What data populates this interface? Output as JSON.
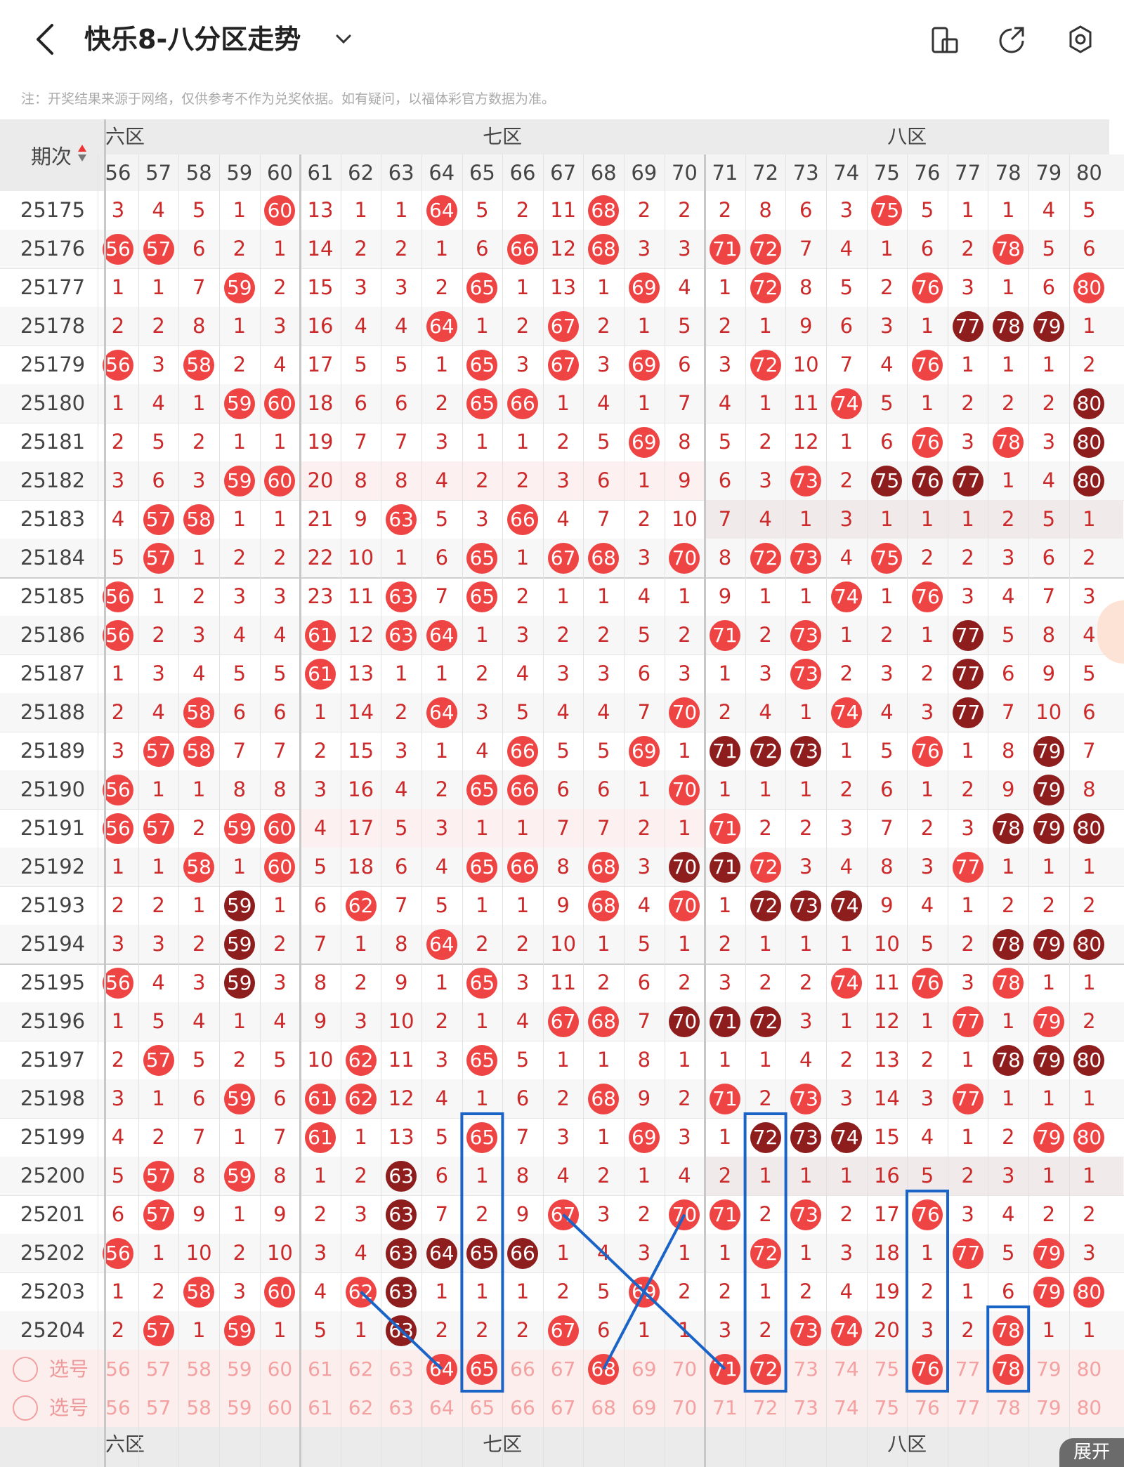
{
  "header": {
    "title": "快乐8-八分区走势",
    "note": "注：开奖结果来源于网络，仅供参考不作为兑奖依据。如有疑问，以福体彩官方数据为准。"
  },
  "table": {
    "period_header": "期次",
    "zones": [
      "六区",
      "七区",
      "八区"
    ],
    "columns": [
      "56",
      "57",
      "58",
      "59",
      "60",
      "61",
      "62",
      "63",
      "64",
      "65",
      "66",
      "67",
      "68",
      "69",
      "70",
      "71",
      "72",
      "73",
      "74",
      "75",
      "76",
      "77",
      "78",
      "79",
      "80"
    ],
    "rows": [
      {
        "period": "25175",
        "cells": [
          "3",
          "4",
          "5",
          "1",
          "c60",
          "13",
          "1",
          "1",
          "c64",
          "5",
          "2",
          "11",
          "c68",
          "2",
          "2",
          "2",
          "8",
          "6",
          "3",
          "c75",
          "5",
          "1",
          "1",
          "4",
          "5"
        ]
      },
      {
        "period": "25176",
        "cells": [
          "c56",
          "c57",
          "6",
          "2",
          "1",
          "14",
          "2",
          "2",
          "1",
          "6",
          "c66",
          "12",
          "c68",
          "3",
          "3",
          "c71",
          "c72",
          "7",
          "4",
          "1",
          "6",
          "2",
          "c78",
          "5",
          "6"
        ]
      },
      {
        "period": "25177",
        "cells": [
          "1",
          "1",
          "7",
          "c59",
          "2",
          "15",
          "3",
          "3",
          "2",
          "c65",
          "1",
          "13",
          "1",
          "c69",
          "4",
          "1",
          "c72",
          "8",
          "5",
          "2",
          "c76",
          "3",
          "1",
          "6",
          "c80"
        ]
      },
      {
        "period": "25178",
        "cells": [
          "2",
          "2",
          "8",
          "1",
          "3",
          "16",
          "4",
          "4",
          "c64",
          "1",
          "2",
          "c67",
          "2",
          "1",
          "5",
          "2",
          "1",
          "9",
          "6",
          "3",
          "1",
          "d77",
          "d78",
          "d79",
          "1"
        ]
      },
      {
        "period": "25179",
        "cells": [
          "c56",
          "3",
          "c58",
          "2",
          "4",
          "17",
          "5",
          "5",
          "1",
          "c65",
          "3",
          "c67",
          "3",
          "c69",
          "6",
          "3",
          "c72",
          "10",
          "7",
          "4",
          "c76",
          "1",
          "1",
          "1",
          "2"
        ]
      },
      {
        "period": "25180",
        "cells": [
          "1",
          "4",
          "1",
          "c59",
          "c60",
          "18",
          "6",
          "6",
          "2",
          "c65",
          "c66",
          "1",
          "4",
          "1",
          "7",
          "4",
          "1",
          "11",
          "c74",
          "5",
          "1",
          "2",
          "2",
          "2",
          "d80"
        ]
      },
      {
        "period": "25181",
        "cells": [
          "2",
          "5",
          "2",
          "1",
          "1",
          "19",
          "7",
          "7",
          "3",
          "1",
          "1",
          "2",
          "5",
          "c69",
          "8",
          "5",
          "2",
          "12",
          "1",
          "6",
          "c76",
          "3",
          "c78",
          "3",
          "d80"
        ]
      },
      {
        "period": "25182",
        "cells": [
          "3",
          "6",
          "3",
          "c59",
          "c60",
          "20",
          "8",
          "8",
          "4",
          "2",
          "2",
          "3",
          "6",
          "1",
          "9",
          "6",
          "3",
          "c73",
          "2",
          "d75",
          "d76",
          "d77",
          "1",
          "4",
          "d80"
        ]
      },
      {
        "period": "25183",
        "cells": [
          "4",
          "c57",
          "c58",
          "1",
          "1",
          "21",
          "9",
          "c63",
          "5",
          "3",
          "c66",
          "4",
          "7",
          "2",
          "10",
          "7",
          "4",
          "1",
          "3",
          "1",
          "1",
          "1",
          "2",
          "5",
          "1"
        ]
      },
      {
        "period": "25184",
        "cells": [
          "5",
          "c57",
          "1",
          "2",
          "2",
          "22",
          "10",
          "1",
          "6",
          "c65",
          "1",
          "c67",
          "c68",
          "3",
          "c70",
          "8",
          "c72",
          "c73",
          "4",
          "c75",
          "2",
          "2",
          "3",
          "6",
          "2"
        ]
      },
      {
        "period": "25185",
        "cells": [
          "c56",
          "1",
          "2",
          "3",
          "3",
          "23",
          "11",
          "c63",
          "7",
          "c65",
          "2",
          "1",
          "1",
          "4",
          "1",
          "9",
          "1",
          "1",
          "c74",
          "1",
          "c76",
          "3",
          "4",
          "7",
          "3"
        ]
      },
      {
        "period": "25186",
        "cells": [
          "c56",
          "2",
          "3",
          "4",
          "4",
          "c61",
          "12",
          "c63",
          "c64",
          "1",
          "3",
          "2",
          "2",
          "5",
          "2",
          "c71",
          "2",
          "c73",
          "1",
          "2",
          "1",
          "d77",
          "5",
          "8",
          "4"
        ]
      },
      {
        "period": "25187",
        "cells": [
          "1",
          "3",
          "4",
          "5",
          "5",
          "c61",
          "13",
          "1",
          "1",
          "2",
          "4",
          "3",
          "3",
          "6",
          "3",
          "1",
          "3",
          "c73",
          "2",
          "3",
          "2",
          "d77",
          "6",
          "9",
          "5"
        ]
      },
      {
        "period": "25188",
        "cells": [
          "2",
          "4",
          "c58",
          "6",
          "6",
          "1",
          "14",
          "2",
          "c64",
          "3",
          "5",
          "4",
          "4",
          "7",
          "c70",
          "2",
          "4",
          "1",
          "c74",
          "4",
          "3",
          "d77",
          "7",
          "10",
          "6"
        ]
      },
      {
        "period": "25189",
        "cells": [
          "3",
          "c57",
          "c58",
          "7",
          "7",
          "2",
          "15",
          "3",
          "1",
          "4",
          "c66",
          "5",
          "5",
          "c69",
          "1",
          "d71",
          "d72",
          "d73",
          "1",
          "5",
          "c76",
          "1",
          "8",
          "d79",
          "7"
        ]
      },
      {
        "period": "25190",
        "cells": [
          "c56",
          "1",
          "1",
          "8",
          "8",
          "3",
          "16",
          "4",
          "2",
          "c65",
          "c66",
          "6",
          "6",
          "1",
          "c70",
          "1",
          "1",
          "1",
          "2",
          "6",
          "1",
          "2",
          "9",
          "d79",
          "8"
        ]
      },
      {
        "period": "25191",
        "cells": [
          "c56",
          "c57",
          "2",
          "c59",
          "c60",
          "4",
          "17",
          "5",
          "3",
          "1",
          "1",
          "7",
          "7",
          "2",
          "1",
          "c71",
          "2",
          "2",
          "3",
          "7",
          "2",
          "3",
          "d78",
          "d79",
          "d80"
        ]
      },
      {
        "period": "25192",
        "cells": [
          "1",
          "1",
          "c58",
          "1",
          "c60",
          "5",
          "18",
          "6",
          "4",
          "c65",
          "c66",
          "8",
          "c68",
          "3",
          "d70",
          "d71",
          "c72",
          "3",
          "4",
          "8",
          "3",
          "c77",
          "1",
          "1",
          "1"
        ]
      },
      {
        "period": "25193",
        "cells": [
          "2",
          "2",
          "1",
          "d59",
          "1",
          "6",
          "c62",
          "7",
          "5",
          "1",
          "1",
          "9",
          "c68",
          "4",
          "c70",
          "1",
          "d72",
          "d73",
          "d74",
          "9",
          "4",
          "1",
          "2",
          "2",
          "2"
        ]
      },
      {
        "period": "25194",
        "cells": [
          "3",
          "3",
          "2",
          "d59",
          "2",
          "7",
          "1",
          "8",
          "c64",
          "2",
          "2",
          "10",
          "1",
          "5",
          "1",
          "2",
          "1",
          "1",
          "1",
          "10",
          "5",
          "2",
          "d78",
          "d79",
          "d80"
        ]
      },
      {
        "period": "25195",
        "cells": [
          "c56",
          "4",
          "3",
          "d59",
          "3",
          "8",
          "2",
          "9",
          "1",
          "c65",
          "3",
          "11",
          "2",
          "6",
          "2",
          "3",
          "2",
          "2",
          "c74",
          "11",
          "c76",
          "3",
          "c78",
          "1",
          "1"
        ]
      },
      {
        "period": "25196",
        "cells": [
          "1",
          "5",
          "4",
          "1",
          "4",
          "9",
          "3",
          "10",
          "2",
          "1",
          "4",
          "c67",
          "c68",
          "7",
          "d70",
          "d71",
          "d72",
          "3",
          "1",
          "12",
          "1",
          "c77",
          "1",
          "c79",
          "2"
        ]
      },
      {
        "period": "25197",
        "cells": [
          "2",
          "c57",
          "5",
          "2",
          "5",
          "10",
          "c62",
          "11",
          "3",
          "c65",
          "5",
          "1",
          "1",
          "8",
          "1",
          "1",
          "1",
          "4",
          "2",
          "13",
          "2",
          "1",
          "d78",
          "d79",
          "d80"
        ]
      },
      {
        "period": "25198",
        "cells": [
          "3",
          "1",
          "6",
          "c59",
          "6",
          "c61",
          "c62",
          "12",
          "4",
          "1",
          "6",
          "2",
          "c68",
          "9",
          "2",
          "c71",
          "2",
          "c73",
          "3",
          "14",
          "3",
          "c77",
          "1",
          "1",
          "1"
        ]
      },
      {
        "period": "25199",
        "cells": [
          "4",
          "2",
          "7",
          "1",
          "7",
          "c61",
          "1",
          "13",
          "5",
          "c65",
          "7",
          "3",
          "1",
          "c69",
          "3",
          "1",
          "d72",
          "d73",
          "d74",
          "15",
          "4",
          "1",
          "2",
          "c79",
          "c80"
        ]
      },
      {
        "period": "25200",
        "cells": [
          "5",
          "c57",
          "8",
          "c59",
          "8",
          "1",
          "2",
          "d63",
          "6",
          "1",
          "8",
          "4",
          "2",
          "1",
          "4",
          "2",
          "1",
          "1",
          "1",
          "16",
          "5",
          "2",
          "3",
          "1",
          "1"
        ]
      },
      {
        "period": "25201",
        "cells": [
          "6",
          "c57",
          "9",
          "1",
          "9",
          "2",
          "3",
          "d63",
          "7",
          "2",
          "9",
          "c67",
          "3",
          "2",
          "c70",
          "c71",
          "2",
          "c73",
          "2",
          "17",
          "c76",
          "3",
          "4",
          "2",
          "2"
        ]
      },
      {
        "period": "25202",
        "cells": [
          "c56",
          "1",
          "10",
          "2",
          "10",
          "3",
          "4",
          "d63",
          "d64",
          "d65",
          "d66",
          "1",
          "4",
          "3",
          "1",
          "1",
          "c72",
          "1",
          "3",
          "18",
          "1",
          "c77",
          "5",
          "c79",
          "3"
        ]
      },
      {
        "period": "25203",
        "cells": [
          "1",
          "2",
          "c58",
          "3",
          "c60",
          "4",
          "c62",
          "d63",
          "1",
          "1",
          "1",
          "2",
          "5",
          "c69",
          "2",
          "2",
          "1",
          "2",
          "4",
          "19",
          "2",
          "1",
          "6",
          "c79",
          "c80"
        ]
      },
      {
        "period": "25204",
        "cells": [
          "2",
          "c57",
          "1",
          "c59",
          "1",
          "5",
          "1",
          "d63",
          "2",
          "2",
          "2",
          "c67",
          "6",
          "1",
          "1",
          "3",
          "2",
          "c73",
          "c74",
          "20",
          "3",
          "2",
          "c78",
          "1",
          "1"
        ]
      }
    ],
    "pick_rows": [
      {
        "label": "选号",
        "selected": [
          "64",
          "65",
          "68",
          "71",
          "72",
          "76",
          "78"
        ]
      },
      {
        "label": "选号",
        "selected": []
      }
    ]
  },
  "footer": {
    "expand_label": "展开"
  },
  "colors": {
    "ball": "#ee4444",
    "dark_ball": "#8e1e1e",
    "text": "#cc2a2a",
    "box": "#1a64c8"
  }
}
